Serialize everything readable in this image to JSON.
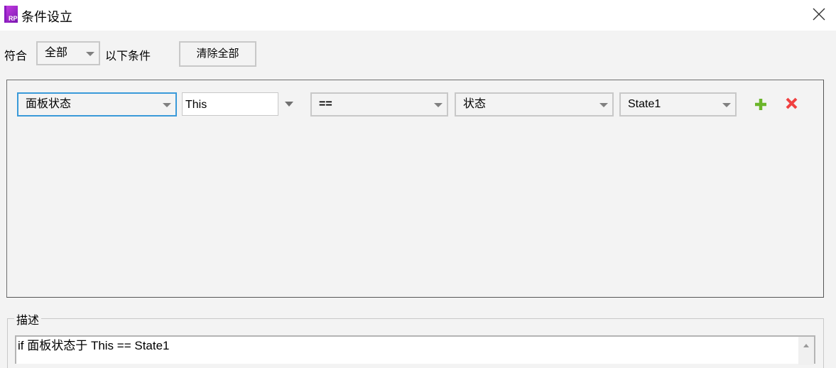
{
  "window": {
    "title": "条件设立",
    "logo_text": "RP"
  },
  "toolbar": {
    "match_label": "符合",
    "match_value": "全部",
    "conditions_label": "以下条件",
    "clear_all": "清除全部"
  },
  "condition_row": {
    "target_type": "面板状态",
    "target_value": "This",
    "operator": "==",
    "value_type": "状态",
    "value": "State1",
    "add_icon": "plus-icon",
    "remove_icon": "close-icon",
    "add_color": "#6bb52a",
    "remove_color": "#f04040"
  },
  "description": {
    "legend": "描述",
    "text": "if 面板状态于 This == State1"
  },
  "colors": {
    "focus_border": "#3a9ad9",
    "background": "#f3f3f3"
  }
}
